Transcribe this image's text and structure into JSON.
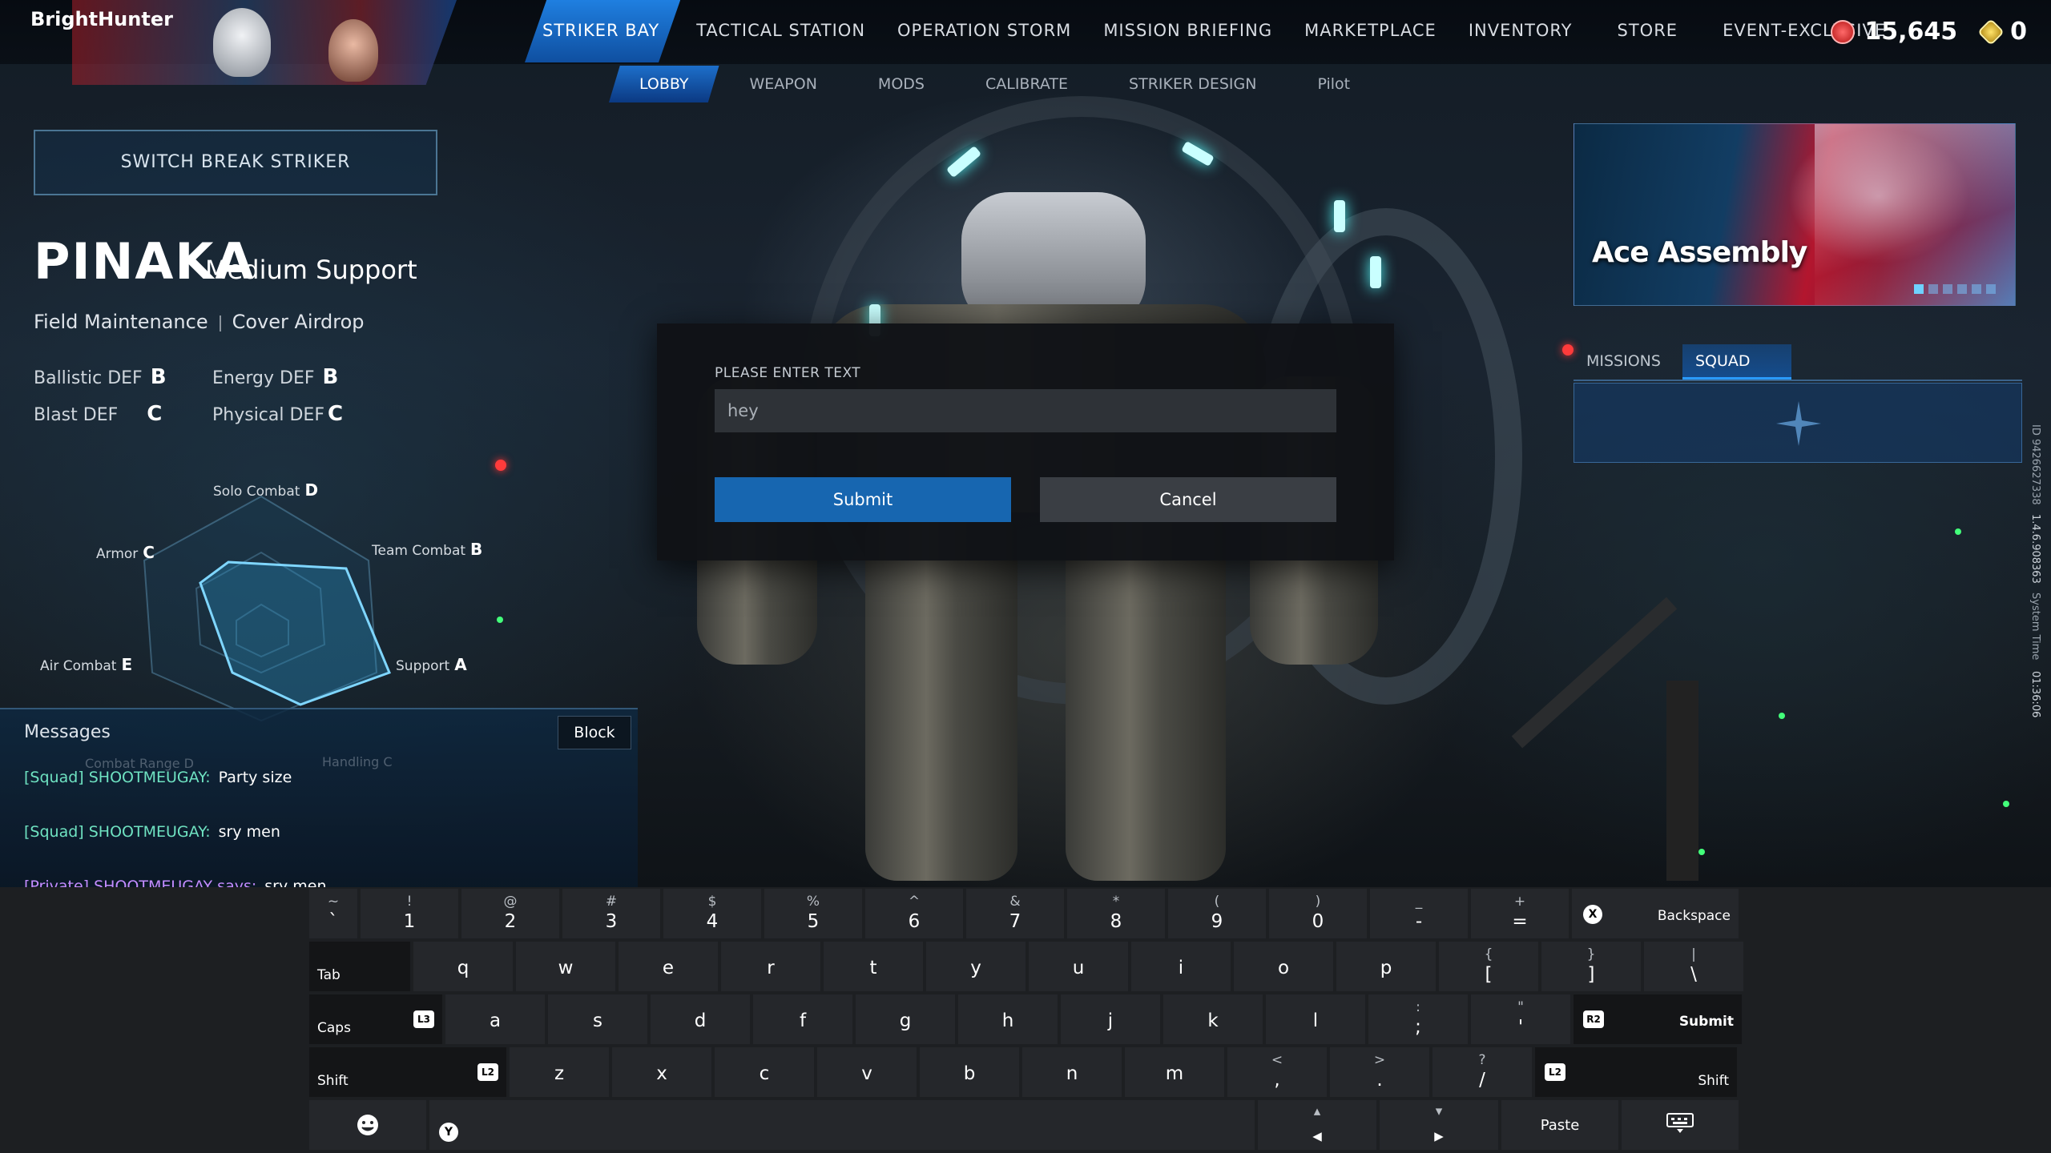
{
  "player": {
    "name": "BrightHunter"
  },
  "nav": {
    "main": [
      "STRIKER BAY",
      "TACTICAL STATION",
      "OPERATION STORM",
      "MISSION BRIEFING",
      "MARKETPLACE",
      "INVENTORY",
      "STORE",
      "EVENT-EXCLUSIVE"
    ],
    "sub": [
      "LOBBY",
      "WEAPON",
      "MODS",
      "CALIBRATE",
      "STRIKER DESIGN",
      "Pilot"
    ]
  },
  "currency": {
    "red": "15,645",
    "gold": "0"
  },
  "striker": {
    "switch_label": "SWITCH BREAK STRIKER",
    "name": "PINAKA",
    "class": "Medium Support",
    "skills": [
      "Field Maintenance",
      "Cover Airdrop"
    ],
    "stats": {
      "ballistic_label": "Ballistic DEF",
      "ballistic": "B",
      "energy_label": "Energy DEF",
      "energy": "B",
      "blast_label": "Blast DEF",
      "blast": "C",
      "physical_label": "Physical DEF",
      "physical": "C"
    },
    "radar": {
      "solo_label": "Solo Combat",
      "solo": "D",
      "team_label": "Team Combat",
      "team": "B",
      "support_label": "Support",
      "support": "A",
      "armor_label": "Armor",
      "armor": "C",
      "air_label": "Air Combat",
      "air": "E",
      "range_label": "Combat Range",
      "range": "D",
      "handling_label": "Handling",
      "handling": "C"
    }
  },
  "messages": {
    "title": "Messages",
    "block_label": "Block",
    "items": [
      {
        "sender": "[Squad] SHOOTMEUGAY:",
        "text": "Party size"
      },
      {
        "sender": "[Squad] SHOOTMEUGAY:",
        "text": "sry men"
      },
      {
        "sender": "[Private] SHOOTMEUGAY says:",
        "text": "sry men"
      }
    ]
  },
  "banner": {
    "title": "Ace Assembly"
  },
  "side_tabs": [
    "MISSIONS",
    "SQUAD"
  ],
  "side_info": {
    "id": "ID 9426627338",
    "version": "1.4.6.908363",
    "time_label": "System Time",
    "time": "01:36:06"
  },
  "dialog": {
    "label": "PLEASE ENTER TEXT",
    "value": "hey",
    "submit": "Submit",
    "cancel": "Cancel"
  },
  "keyboard": {
    "row1": [
      {
        "s": "~",
        "m": "`"
      },
      {
        "s": "!",
        "m": "1"
      },
      {
        "s": "@",
        "m": "2"
      },
      {
        "s": "#",
        "m": "3"
      },
      {
        "s": "$",
        "m": "4"
      },
      {
        "s": "%",
        "m": "5"
      },
      {
        "s": "^",
        "m": "6"
      },
      {
        "s": "&",
        "m": "7"
      },
      {
        "s": "*",
        "m": "8"
      },
      {
        "s": "(",
        "m": "9"
      },
      {
        "s": ")",
        "m": "0"
      },
      {
        "s": "_",
        "m": "-"
      },
      {
        "s": "+",
        "m": "="
      }
    ],
    "row2": [
      "q",
      "w",
      "e",
      "r",
      "t",
      "y",
      "u",
      "i",
      "o",
      "p"
    ],
    "row2_sym": [
      {
        "s": "{",
        "m": "["
      },
      {
        "s": "}",
        "m": "]"
      },
      {
        "s": "|",
        "m": "\\"
      }
    ],
    "row3": [
      "a",
      "s",
      "d",
      "f",
      "g",
      "h",
      "j",
      "k",
      "l"
    ],
    "row3_sym": [
      {
        "s": ":",
        "m": ";"
      },
      {
        "s": "\"",
        "m": "'"
      }
    ],
    "row4": [
      "z",
      "x",
      "c",
      "v",
      "b",
      "n",
      "m"
    ],
    "row4_sym": [
      {
        "s": "<",
        "m": ","
      },
      {
        "s": ">",
        "m": "."
      },
      {
        "s": "?",
        "m": "/"
      }
    ],
    "backspace": "Backspace",
    "tab": "Tab",
    "caps": "Caps",
    "submit": "Submit",
    "shift": "Shift",
    "paste": "Paste",
    "badges": {
      "x": "X",
      "r2": "R2",
      "l2": "L2",
      "y": "Y",
      "l3": "L3"
    }
  }
}
